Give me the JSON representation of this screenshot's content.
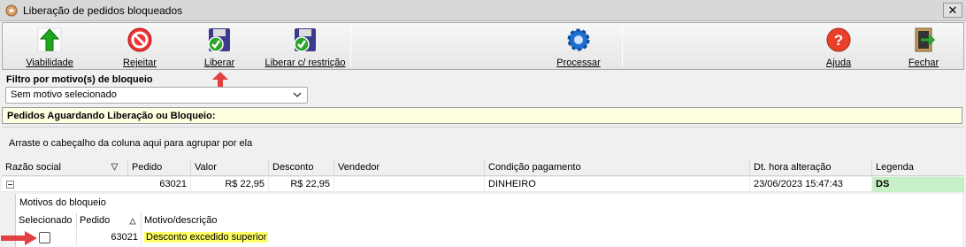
{
  "window": {
    "title": "Liberação de pedidos bloqueados",
    "close_glyph": "✕"
  },
  "toolbar": {
    "viabilidade": "Viabilidade",
    "rejeitar": "Rejeitar",
    "liberar": "Liberar",
    "liberar_restricao": "Liberar c/ restrição",
    "processar": "Processar",
    "ajuda": "Ajuda",
    "fechar": "Fechar"
  },
  "filter": {
    "label": "Filtro por motivo(s) de bloqueio",
    "selected": "Sem motivo selecionado"
  },
  "pending_title": "Pedidos Aguardando Liberação ou Bloqueio:",
  "group_hint": "Arraste o cabeçalho da coluna aqui para agrupar por ela",
  "grid": {
    "columns": [
      "Razão social",
      "Pedido",
      "Valor",
      "Desconto",
      "Vendedor",
      "Condição pagamento",
      "Dt. hora alteração",
      "Legenda"
    ],
    "row": {
      "razao_social": "",
      "pedido": "63021",
      "valor": "R$ 22,95",
      "desconto": "R$ 22,95",
      "vendedor": "",
      "condicao": "DINHEIRO",
      "dt_hora": "23/06/2023 15:47:43",
      "legenda": "DS"
    }
  },
  "detail": {
    "title": "Motivos do bloqueio",
    "columns": [
      "Selecionado",
      "Pedido",
      "Motivo/descrição"
    ],
    "row": {
      "pedido": "63021",
      "motivo": "Desconto excedido superior"
    }
  },
  "colors": {
    "highlight": "#ffff66",
    "legend_ds": "#c6f0c6",
    "pending_bg": "#ffffe1",
    "arrow": "#e04040"
  }
}
